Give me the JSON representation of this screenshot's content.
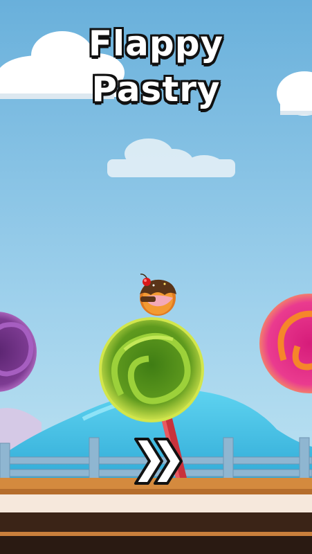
{
  "game": {
    "title_line1": "Flappy",
    "title_line2": "Pastry",
    "play_icon": "double-chevron-right-icon"
  },
  "colors": {
    "sky_top": "#6fb6dd",
    "sky_bottom": "#bfe3f1",
    "hill": "#4fc4e6",
    "lollipop_green": "#6aa824",
    "lollipop_purple": "#7b3a8f",
    "lollipop_pink": "#e8338a",
    "ground": "#d08a3e"
  }
}
